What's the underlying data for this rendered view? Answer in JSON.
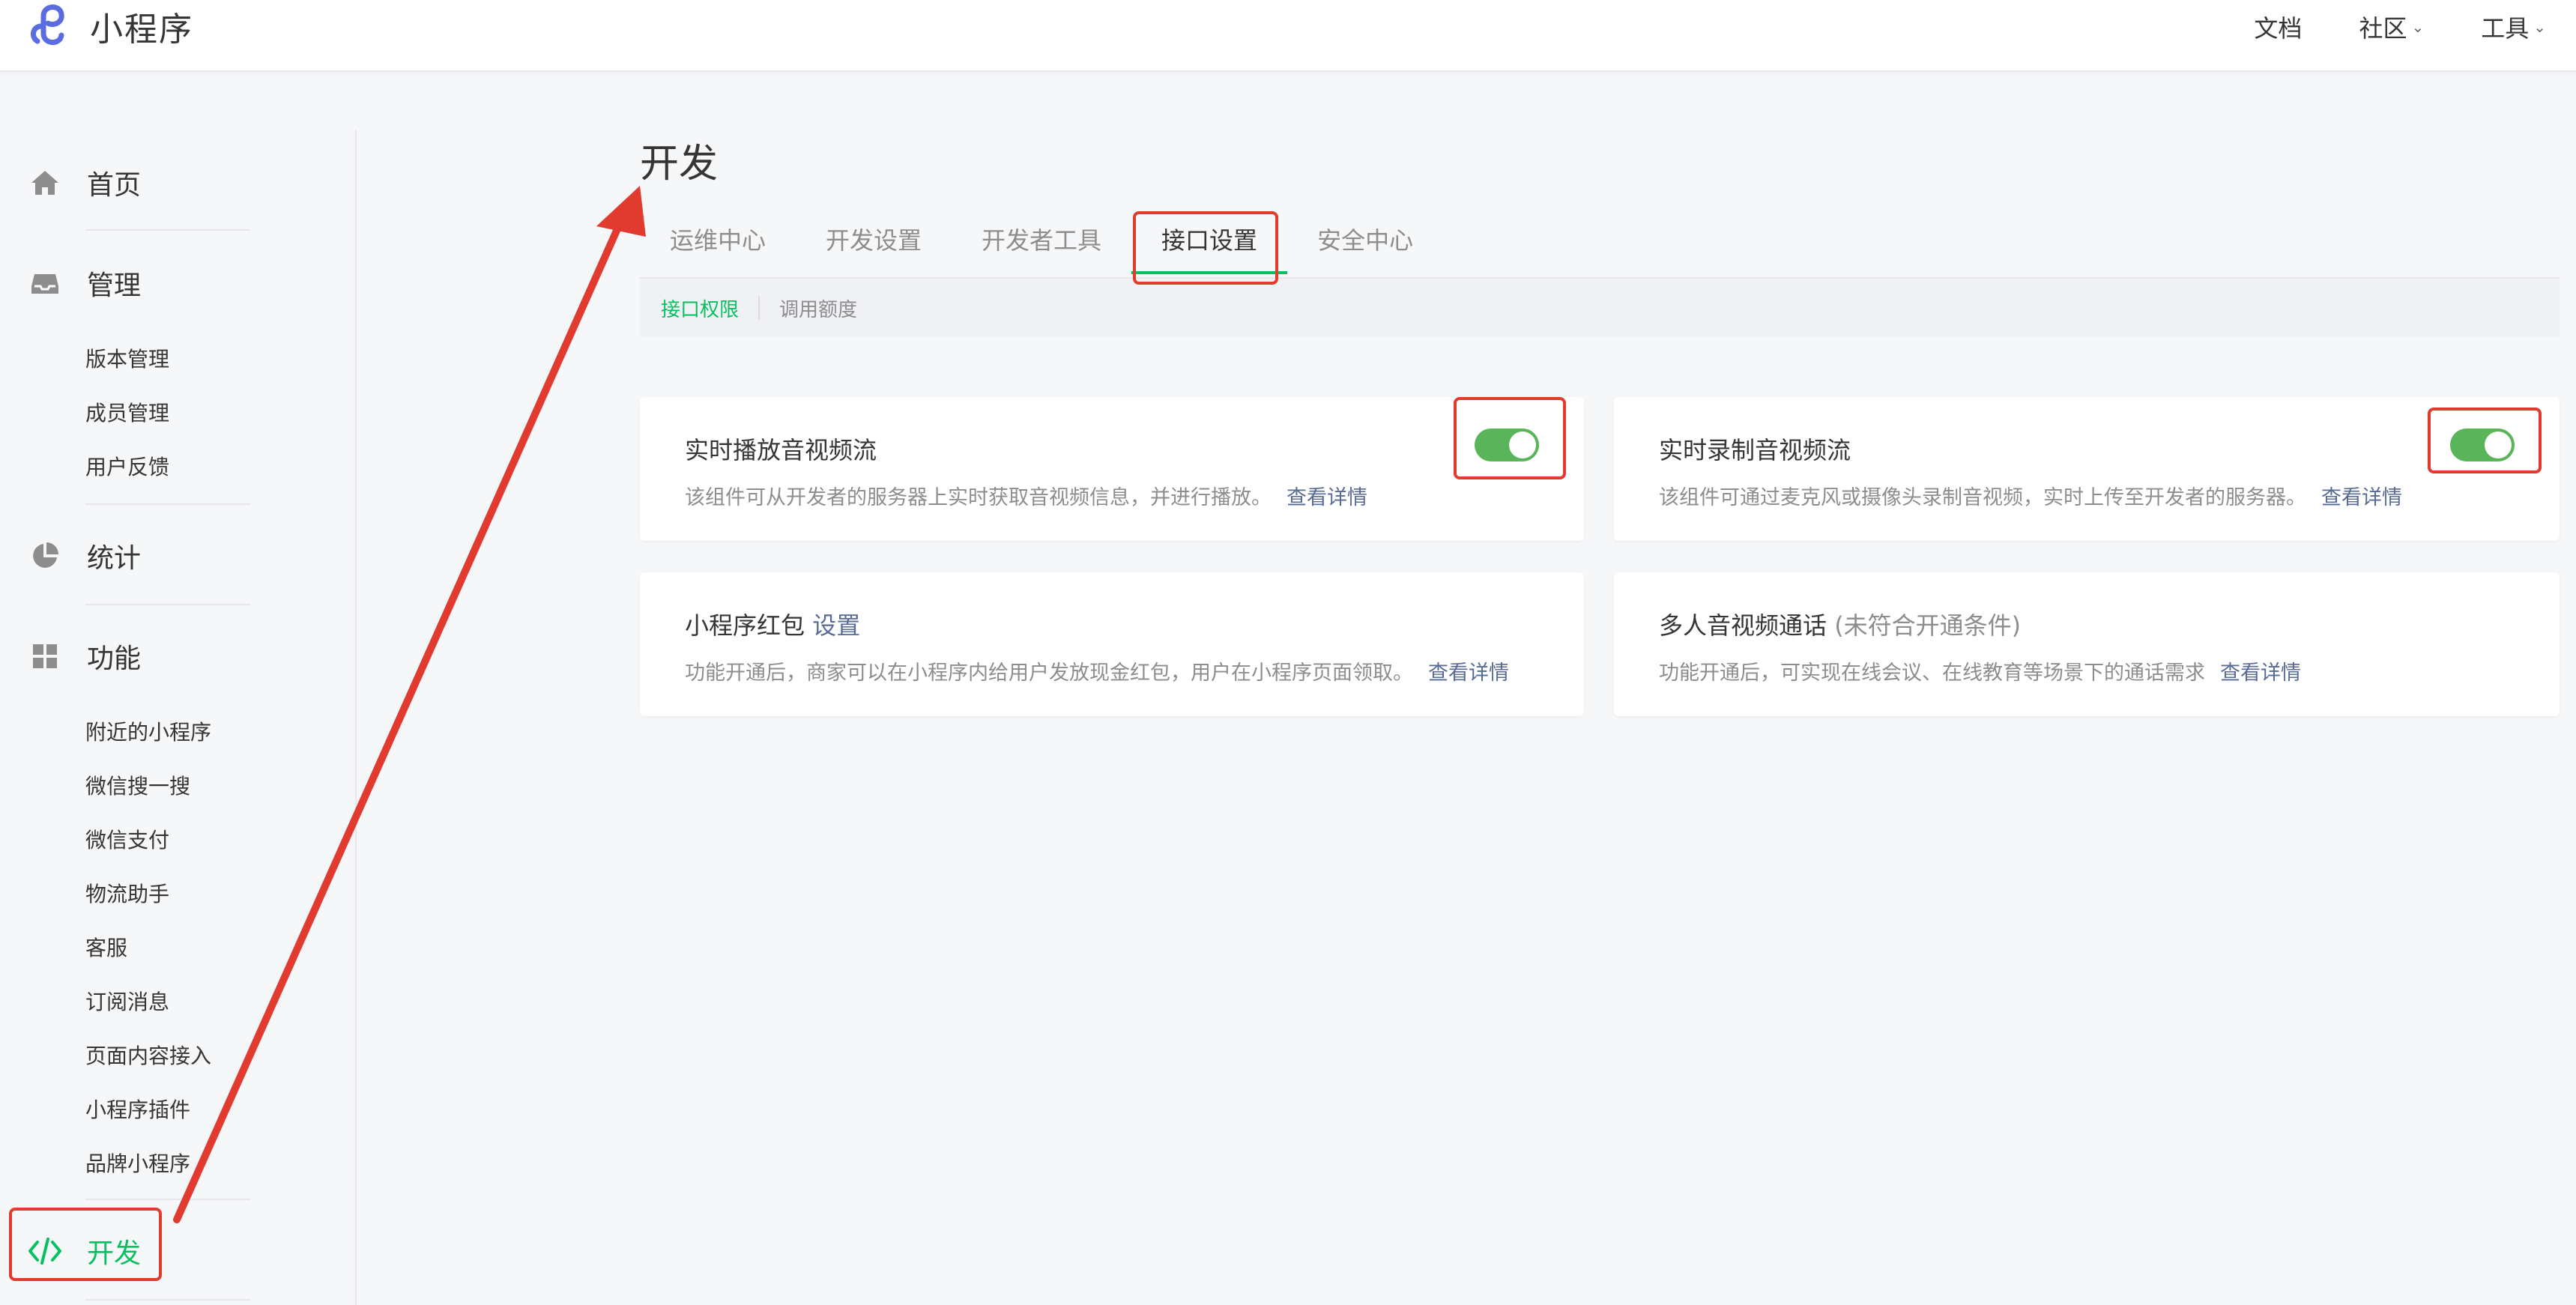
{
  "app": {
    "title": "小程序"
  },
  "topnav": [
    {
      "label": "文档",
      "has_dropdown": false
    },
    {
      "label": "社区",
      "has_dropdown": true
    },
    {
      "label": "工具",
      "has_dropdown": true
    }
  ],
  "sidebar": {
    "home": "首页",
    "manage": {
      "label": "管理",
      "items": [
        "版本管理",
        "成员管理",
        "用户反馈"
      ]
    },
    "stats": "统计",
    "features": {
      "label": "功能",
      "items": [
        "附近的小程序",
        "微信搜一搜",
        "微信支付",
        "物流助手",
        "客服",
        "订阅消息",
        "页面内容接入",
        "小程序插件",
        "品牌小程序"
      ]
    },
    "develop": "开发"
  },
  "main": {
    "title": "开发",
    "tabs": [
      "运维中心",
      "开发设置",
      "开发者工具",
      "接口设置",
      "安全中心"
    ],
    "active_tab": "接口设置",
    "subtabs": [
      "接口权限",
      "调用额度"
    ],
    "cards": [
      {
        "title": "实时播放音视频流",
        "desc": "该组件可从开发者的服务器上实时获取音视频信息，并进行播放。",
        "more": "查看详情",
        "enabled": true
      },
      {
        "title": "实时录制音视频流",
        "desc": "该组件可通过麦克风或摄像头录制音视频，实时上传至开发者的服务器。",
        "more": "查看详情",
        "enabled": true
      },
      {
        "title": "小程序红包",
        "title_link": "设置",
        "desc": "功能开通后，商家可以在小程序内给用户发放现金红包，用户在小程序页面领取。",
        "more": "查看详情"
      },
      {
        "title": "多人音视频通话",
        "title_note": "(未符合开通条件)",
        "desc": "功能开通后，可实现在线会议、在线教育等场景下的通话需求",
        "more": "查看详情"
      }
    ]
  },
  "colors": {
    "accent": "#07c160",
    "link": "#576b95",
    "toggle_on": "#5ab45a",
    "annotation": "#e03b2e"
  }
}
